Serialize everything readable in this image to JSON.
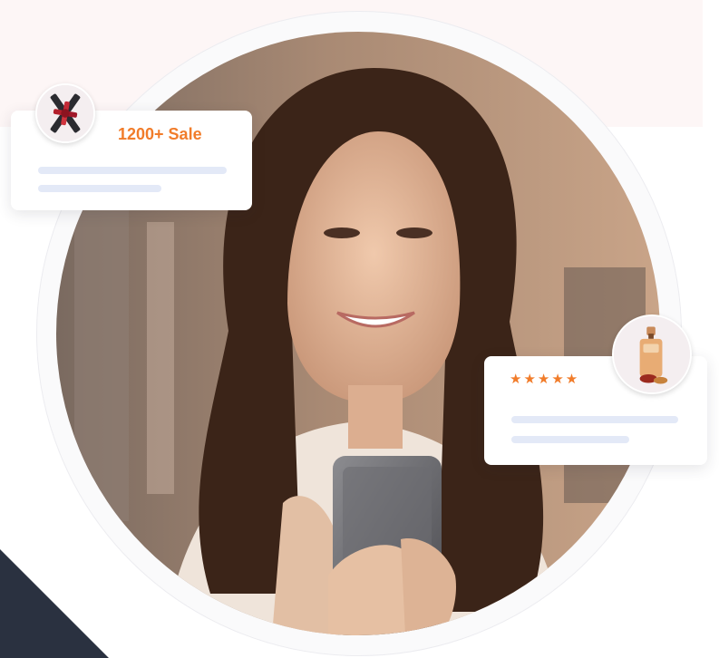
{
  "sale_card": {
    "title": "1200+ Sale",
    "thumbnail_icon": "lipstick-product-icon"
  },
  "review_card": {
    "stars": "★★★★★",
    "rating": 5,
    "thumbnail_icon": "perfume-bottle-icon"
  },
  "colors": {
    "accent": "#f17c2a",
    "placeholder_line": "#e3e9f7",
    "dark_corner": "#2a3140"
  }
}
